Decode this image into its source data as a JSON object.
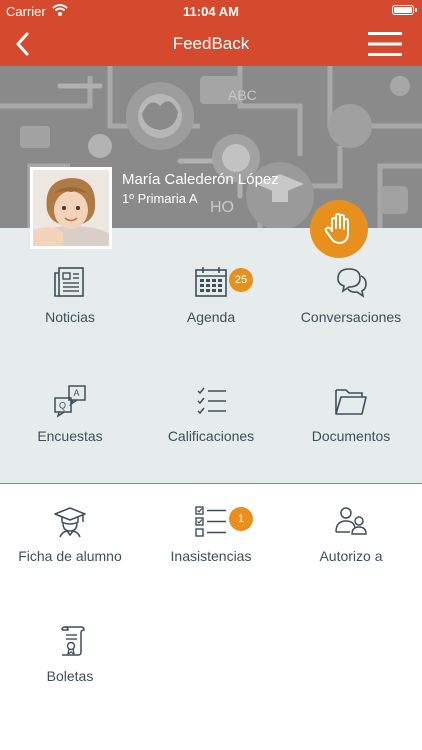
{
  "status_bar": {
    "carrier": "Carrier",
    "time": "11:04 AM"
  },
  "nav": {
    "title": "FeedBack"
  },
  "profile": {
    "name": "María Calederón López",
    "class": "1º Primaria A"
  },
  "tiles": [
    {
      "label": "Noticias",
      "icon": "newspaper-icon"
    },
    {
      "label": "Agenda",
      "icon": "calendar-icon",
      "badge": "25"
    },
    {
      "label": "Conversaciones",
      "icon": "chat-bubbles-icon"
    },
    {
      "label": "Encuestas",
      "icon": "survey-icon"
    },
    {
      "label": "Calificaciones",
      "icon": "checklist-icon"
    },
    {
      "label": "Documentos",
      "icon": "folder-icon"
    },
    {
      "label": "Ficha de alumno",
      "icon": "graduation-cap-icon"
    },
    {
      "label": "Inasistencias",
      "icon": "attendance-list-icon",
      "badge": "1"
    },
    {
      "label": "Autorizo a",
      "icon": "people-icon"
    },
    {
      "label": "Boletas",
      "icon": "certificate-icon"
    }
  ],
  "colors": {
    "header": "#d54a2e",
    "accent": "#e8901d",
    "icon": "#3e4f59",
    "top_grid_bg": "#e6ebeb"
  }
}
